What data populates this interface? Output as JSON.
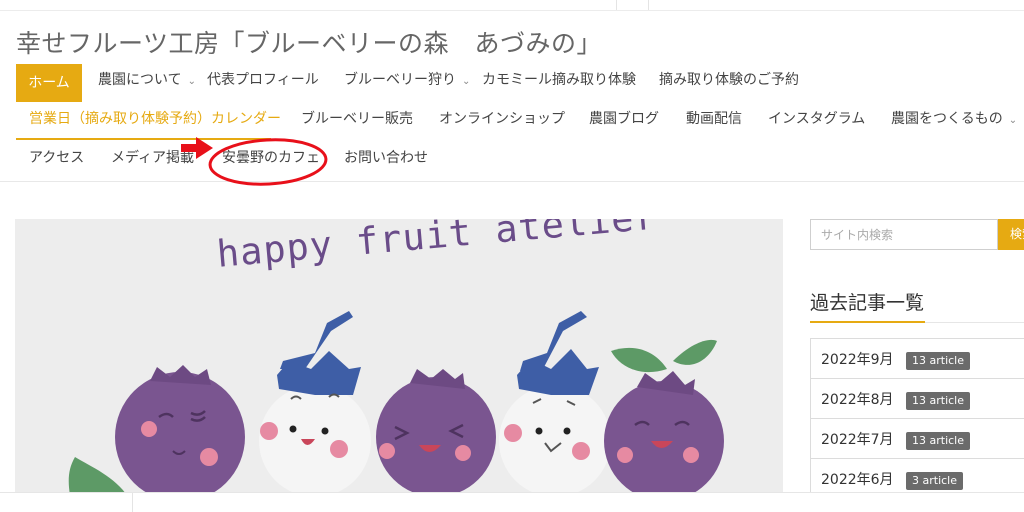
{
  "site": {
    "title": "幸せフルーツ工房「ブルーベリーの森　あづみの」"
  },
  "nav": {
    "home": "ホーム",
    "farm_about": "農園について",
    "representative": "代表プロフィール",
    "blueberry_picking": "ブルーベリー狩り",
    "chamomile": "カモミール摘み取り体験",
    "reservation": "摘み取り体験のご予約",
    "calendar": "営業日（摘み取り体験予約）カレンダー",
    "blueberry_sales": "ブルーベリー販売",
    "online_shop": "オンラインショップ",
    "farm_blog": "農園ブログ",
    "video": "動画配信",
    "instagram": "インスタグラム",
    "farm_makers": "農園をつくるもの",
    "access": "アクセス",
    "media": "メディア掲載",
    "cafe": "安曇野のカフェ",
    "contact": "お問い合わせ"
  },
  "hero": {
    "text": "happy fruit atelier"
  },
  "search": {
    "placeholder": "サイト内検索",
    "button": "検索"
  },
  "archive": {
    "title": "過去記事一覧",
    "items": [
      {
        "month": "2022年9月",
        "count": "13 article"
      },
      {
        "month": "2022年8月",
        "count": "13 article"
      },
      {
        "month": "2022年7月",
        "count": "13 article"
      },
      {
        "month": "2022年6月",
        "count": "3 article"
      }
    ]
  },
  "colors": {
    "accent": "#e6aa12",
    "grape": "#7a5590",
    "annotation": "#e8101a"
  }
}
